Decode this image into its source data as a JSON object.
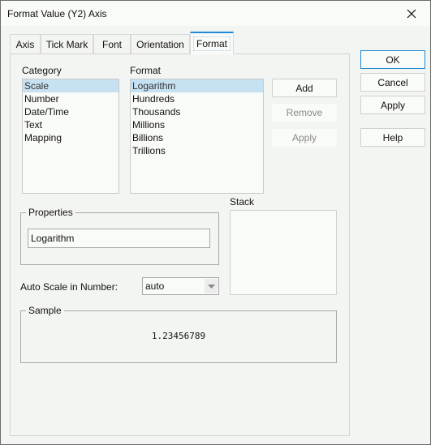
{
  "window": {
    "title": "Format Value (Y2) Axis",
    "close_icon": "close-icon"
  },
  "tabs": [
    {
      "label": "Axis",
      "selected": false
    },
    {
      "label": "Tick Mark",
      "selected": false
    },
    {
      "label": "Font",
      "selected": false
    },
    {
      "label": "Orientation",
      "selected": false
    },
    {
      "label": "Format",
      "selected": true
    }
  ],
  "category": {
    "label": "Category",
    "items": [
      "Scale",
      "Number",
      "Date/Time",
      "Text",
      "Mapping"
    ],
    "selected": "Scale"
  },
  "format": {
    "label": "Format",
    "items": [
      "Logarithm",
      "Hundreds",
      "Thousands",
      "Millions",
      "Billions",
      "Trillions"
    ],
    "selected": "Logarithm"
  },
  "format_buttons": {
    "add": "Add",
    "remove": "Remove",
    "apply": "Apply"
  },
  "properties": {
    "legend": "Properties",
    "value": "Logarithm"
  },
  "stack": {
    "label": "Stack"
  },
  "auto_scale": {
    "label": "Auto Scale in Number:",
    "value": "auto"
  },
  "sample": {
    "legend": "Sample",
    "value": "1.23456789"
  },
  "dialog_buttons": {
    "ok": "OK",
    "cancel": "Cancel",
    "apply": "Apply",
    "help": "Help"
  },
  "colors": {
    "accent": "#1f8ad3",
    "selection": "#c6e1f2",
    "background": "#f3f5f2"
  }
}
